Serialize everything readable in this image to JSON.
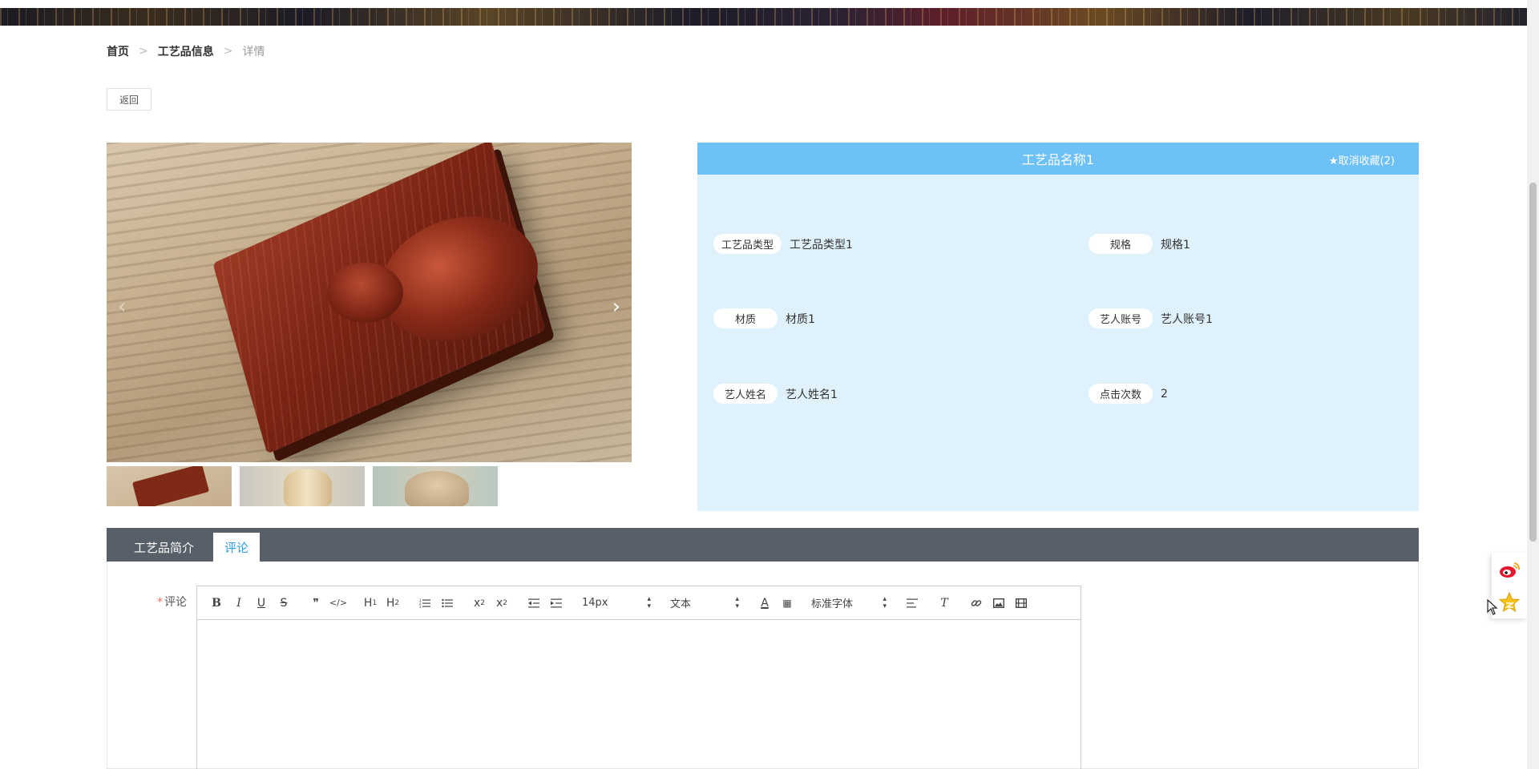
{
  "breadcrumb": {
    "home": "首页",
    "list": "工艺品信息",
    "current": "详情",
    "separator": ">"
  },
  "back_button": "返回",
  "gallery": {
    "prev_arrow": "‹",
    "next_arrow": "›",
    "image_count": 3
  },
  "product": {
    "name": "工艺品名称1",
    "favorite_label": "★取消收藏(2)",
    "fields": [
      {
        "label": "工艺品类型",
        "value": "工艺品类型1"
      },
      {
        "label": "规格",
        "value": "规格1"
      },
      {
        "label": "材质",
        "value": "材质1"
      },
      {
        "label": "艺人账号",
        "value": "艺人账号1"
      },
      {
        "label": "艺人姓名",
        "value": "艺人姓名1"
      },
      {
        "label": "点击次数",
        "value": "2"
      }
    ]
  },
  "tabs": [
    {
      "label": "工艺品简介",
      "active": false
    },
    {
      "label": "评论",
      "active": true
    }
  ],
  "comment_form": {
    "required_mark": "*",
    "label": "评论",
    "font_size": "14px",
    "text_style": "文本",
    "font_family": "标准字体",
    "h1": "H",
    "h2": "H",
    "h1_sub": "1",
    "h2_sub": "2",
    "sub": "x",
    "sup": "x",
    "sub_mark": "2",
    "sup_mark": "2",
    "clear": "T"
  },
  "colors": {
    "header_blue": "#6ec1f7",
    "panel_bg": "#dff2fc",
    "tab_bar": "#575f68",
    "active_tab_text": "#2d9ee8"
  }
}
